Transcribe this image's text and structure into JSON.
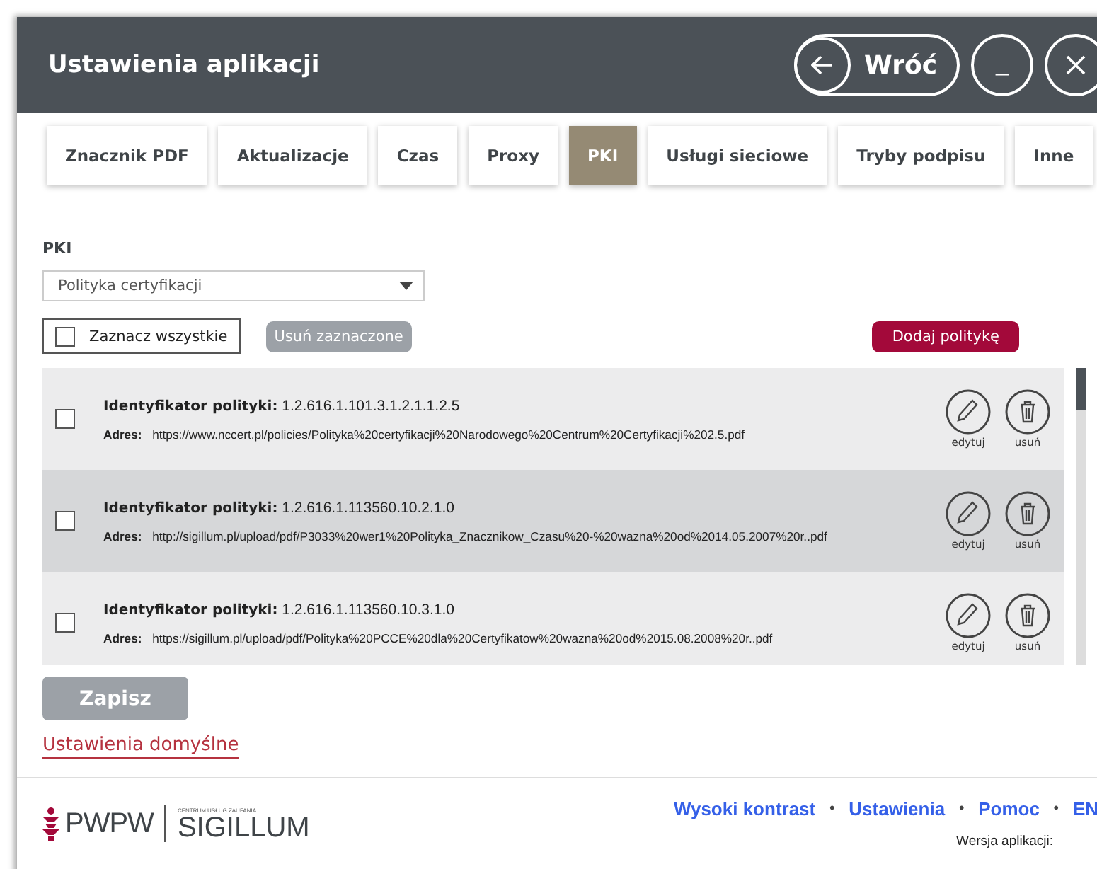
{
  "window": {
    "title": "Ustawienia aplikacji",
    "back_button": "Wróć",
    "minimize_button": "_"
  },
  "tabs": [
    {
      "label": "Znacznik PDF",
      "selected": false
    },
    {
      "label": "Aktualizacje",
      "selected": false
    },
    {
      "label": "Czas",
      "selected": false
    },
    {
      "label": "Proxy",
      "selected": false
    },
    {
      "label": "PKI",
      "selected": true
    },
    {
      "label": "Usługi sieciowe",
      "selected": false
    },
    {
      "label": "Tryby podpisu",
      "selected": false
    },
    {
      "label": "Inne",
      "selected": false
    }
  ],
  "section_label": "PKI",
  "dropdown": {
    "value": "Polityka certyfikacji"
  },
  "select_all": {
    "label": "Zaznacz wszystkie",
    "checked": false
  },
  "delete_selected_button": {
    "label": "Usuń zaznaczone",
    "disabled": true
  },
  "add_policy_button": "Dodaj politykę",
  "policies": [
    {
      "id_label": "Identyfikator polityki:",
      "id": "1.2.616.1.101.3.1.2.1.1.2.5",
      "address_label": "Adres:",
      "address": "https://www.nccert.pl/policies/Polityka%20certyfikacji%20Narodowego%20Centrum%20Certyfikacji%202.5.pdf",
      "checked": false,
      "highlighted": false,
      "edit_label": "edytuj",
      "delete_label": "usuń"
    },
    {
      "id_label": "Identyfikator polityki:",
      "id": "1.2.616.1.113560.10.2.1.0",
      "address_label": "Adres:",
      "address": "http://sigillum.pl/upload/pdf/P3033%20wer1%20Polityka_Znacznikow_Czasu%20-%20wazna%20od%2014.05.2007%20r..pdf",
      "checked": false,
      "highlighted": true,
      "edit_label": "edytuj",
      "delete_label": "usuń"
    },
    {
      "id_label": "Identyfikator polityki:",
      "id": "1.2.616.1.113560.10.3.1.0",
      "address_label": "Adres:",
      "address": "https://sigillum.pl/upload/pdf/Polityka%20PCCE%20dla%20Certyfikatow%20wazna%20od%2015.08.2008%20r..pdf",
      "checked": false,
      "highlighted": false,
      "edit_label": "edytuj",
      "delete_label": "usuń"
    }
  ],
  "save_button": {
    "label": "Zapisz",
    "disabled": true
  },
  "defaults_link": "Ustawienia domyślne",
  "footer": {
    "logo": {
      "brand": "PWPW",
      "tagline": "CENTRUM USŁUG ZAUFANIA",
      "product": "SIGILLUM"
    },
    "links": [
      "Wysoki kontrast",
      "Ustawienia",
      "Pomoc",
      "EN"
    ],
    "separator": "•",
    "version_label": "Wersja aplikacji:"
  }
}
